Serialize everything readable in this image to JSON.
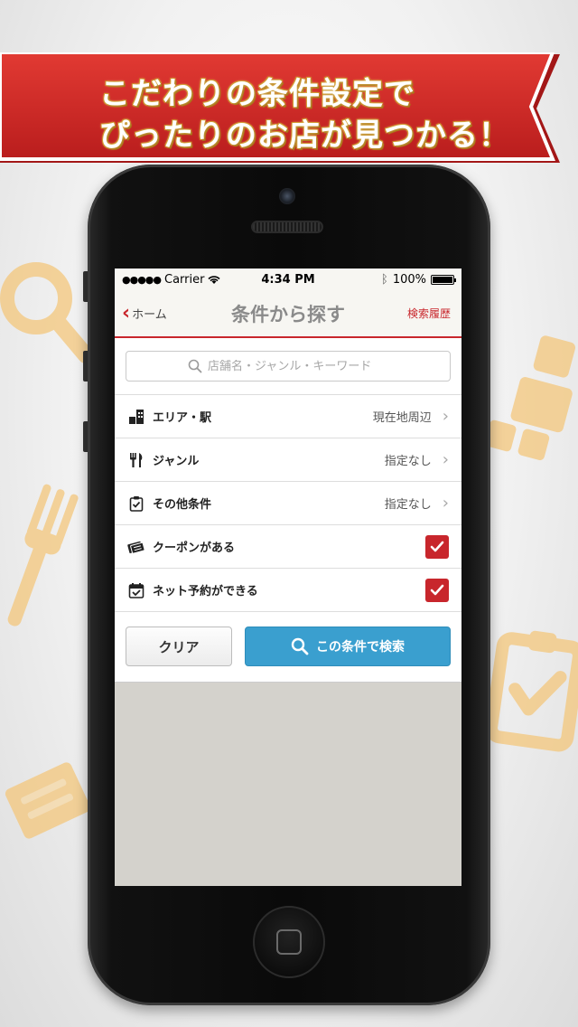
{
  "banner": {
    "line1": "こだわりの条件設定で",
    "line2": "ぴったりのお店が見つかる！"
  },
  "status_bar": {
    "carrier": "Carrier",
    "time": "4:34 PM",
    "battery": "100%",
    "battery_level": 1.0
  },
  "nav": {
    "back_label": "ホーム",
    "title": "条件から探す",
    "history_label": "検索履歴"
  },
  "search": {
    "placeholder": "店舗名・ジャンル・キーワード"
  },
  "conditions": [
    {
      "icon": "building-icon",
      "label": "エリア・駅",
      "value": "現在地周辺"
    },
    {
      "icon": "fork-knife-icon",
      "label": "ジャンル",
      "value": "指定なし"
    },
    {
      "icon": "clipboard-check-icon",
      "label": "その他条件",
      "value": "指定なし"
    }
  ],
  "toggles": [
    {
      "icon": "coupon-icon",
      "label": "クーポンがある",
      "checked": true
    },
    {
      "icon": "calendar-check-icon",
      "label": "ネット予約ができる",
      "checked": true
    }
  ],
  "actions": {
    "clear_label": "クリア",
    "search_label": "この条件で検索"
  },
  "colors": {
    "accent_red": "#c8262c",
    "search_blue": "#3a9fcf",
    "icon_bg": "#f4c77c"
  }
}
